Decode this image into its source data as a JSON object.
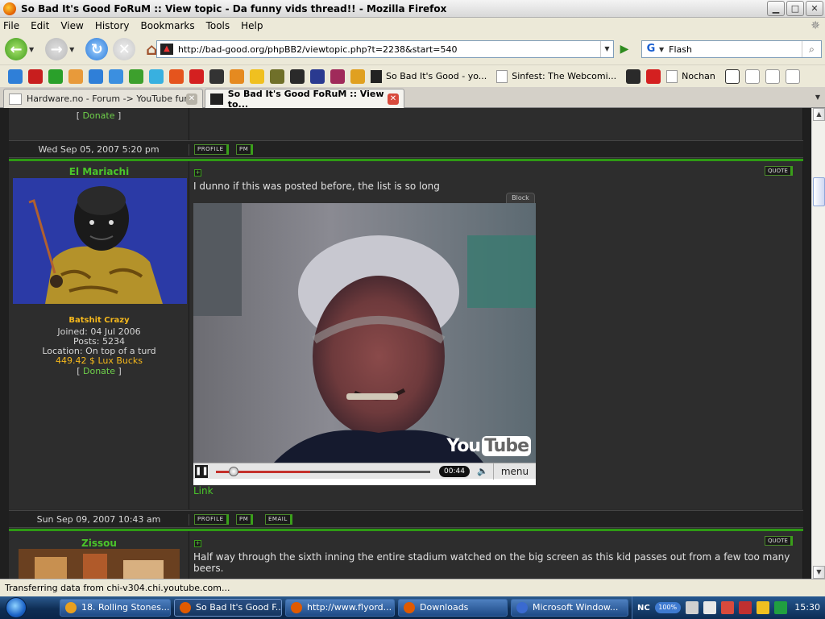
{
  "window": {
    "title": "So Bad It's Good FoRuM :: View topic - Da funny vids thread!! - Mozilla Firefox",
    "buttons": [
      "minimize",
      "maximize",
      "close"
    ]
  },
  "menu": [
    "File",
    "Edit",
    "View",
    "History",
    "Bookmarks",
    "Tools",
    "Help"
  ],
  "nav": {
    "url": "http://bad-good.org/phpBB2/viewtopic.php?t=2238&start=540",
    "search_value": "Flash"
  },
  "bookmarks": {
    "text_items": [
      "So Bad It's Good - yo...",
      "Sinfest: The Webcomi...",
      "Nochan"
    ],
    "icon_colors": [
      "#2f7fd8",
      "#c81e1e",
      "#2aa02a",
      "#e89a3a",
      "#2f7fd8",
      "#3b8fe0",
      "#3da02d",
      "#38b0e0",
      "#e5541d",
      "#d42020",
      "#333333",
      "#e58a20",
      "#f0c020",
      "#70702a",
      "#2a2a2a",
      "#2a3a90",
      "#a02a5a",
      "#e0a020",
      "#2a2a2a"
    ]
  },
  "tabs": [
    {
      "label": "Hardware.no - Forum -> YouTube fun...",
      "active": false
    },
    {
      "label": "So Bad It's Good FoRuM :: View to...",
      "active": true
    }
  ],
  "forum": {
    "top_donate_prefix": "[ ",
    "top_donate_link": "Donate",
    "top_donate_suffix": " ]",
    "post1_date": "Wed Sep 05, 2007 5:20 pm",
    "post1_buttons": [
      "PROFILE",
      "PM"
    ],
    "post2": {
      "username": "El Mariachi",
      "rank": "Batshit Crazy",
      "joined": "Joined: 04 Jul 2006",
      "posts": "Posts: 5234",
      "location": "Location: On top of a turd",
      "bucks": "449.42 $ Lux Bucks",
      "donate_prefix": "[ ",
      "donate_link": "Donate",
      "donate_suffix": " ]",
      "quote_label": "QUOTE",
      "text": "I dunno if this was posted before, the list is so long",
      "block_label": "Block",
      "video": {
        "time": "00:44",
        "menu_label": "menu",
        "logo_you": "You",
        "logo_tube": "Tube",
        "progress": 0.06,
        "buffered": 0.44
      },
      "link_label": "Link",
      "date": "Sun Sep 09, 2007 10:43 am",
      "buttons": [
        "PROFILE",
        "PM",
        "EMAIL"
      ]
    },
    "post3": {
      "username": "Zissou",
      "quote_label": "QUOTE",
      "text": "Half way through the sixth inning the entire stadium watched on the big screen as this kid passes out from a few too many beers."
    }
  },
  "status": "Transferring data from chi-v304.chi.youtube.com...",
  "taskbar": {
    "items": [
      {
        "label": "18. Rolling Stones...",
        "active": false,
        "color": "#e8a020"
      },
      {
        "label": "So Bad It's Good F...",
        "active": true,
        "color": "#e05a00"
      },
      {
        "label": "http://www.flyord...",
        "active": false,
        "color": "#e05a00"
      },
      {
        "label": "Downloads",
        "active": false,
        "color": "#e05a00"
      },
      {
        "label": "Microsoft Window...",
        "active": false,
        "color": "#3a6ad0"
      }
    ],
    "tray_nc": "NC",
    "tray_pct": "100%",
    "clock": "15:30"
  }
}
